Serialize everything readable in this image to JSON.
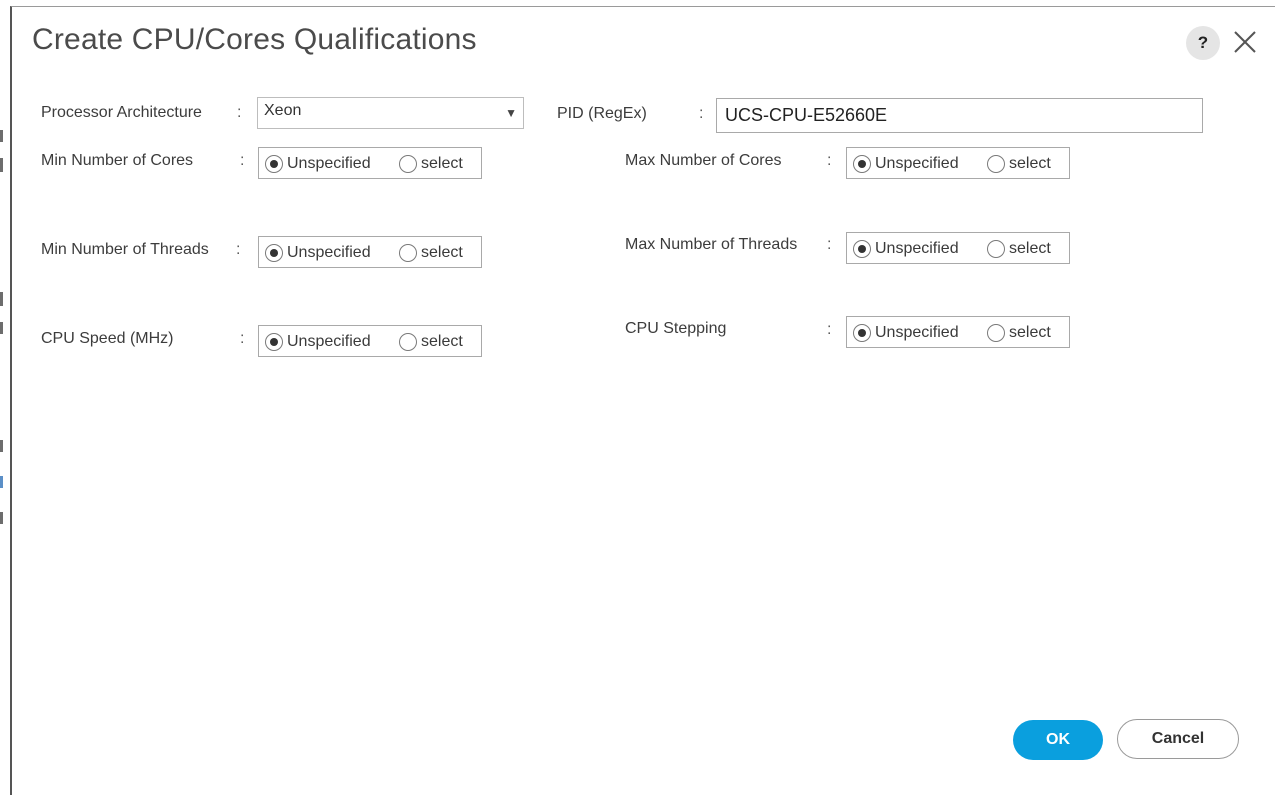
{
  "dialog": {
    "title": "Create CPU/Cores Qualifications",
    "help_label": "?"
  },
  "form": {
    "colon": ":",
    "processor_architecture": {
      "label": "Processor Architecture",
      "selected": "Xeon"
    },
    "pid": {
      "label": "PID (RegEx)",
      "value": "UCS-CPU-E52660E"
    },
    "option_unspecified": "Unspecified",
    "option_select": "select",
    "min_cores": {
      "label": "Min Number of Cores",
      "selected": "Unspecified"
    },
    "max_cores": {
      "label": "Max Number of Cores",
      "selected": "Unspecified"
    },
    "min_threads": {
      "label": "Min Number of Threads",
      "selected": "Unspecified"
    },
    "max_threads": {
      "label": "Max Number of Threads",
      "selected": "Unspecified"
    },
    "cpu_speed": {
      "label": "CPU Speed (MHz)",
      "selected": "Unspecified"
    },
    "cpu_stepping": {
      "label": "CPU Stepping",
      "selected": "Unspecified"
    }
  },
  "buttons": {
    "ok": "OK",
    "cancel": "Cancel"
  },
  "colors": {
    "primary_button": "#0a9fde",
    "title_text": "#4b4b4b"
  }
}
